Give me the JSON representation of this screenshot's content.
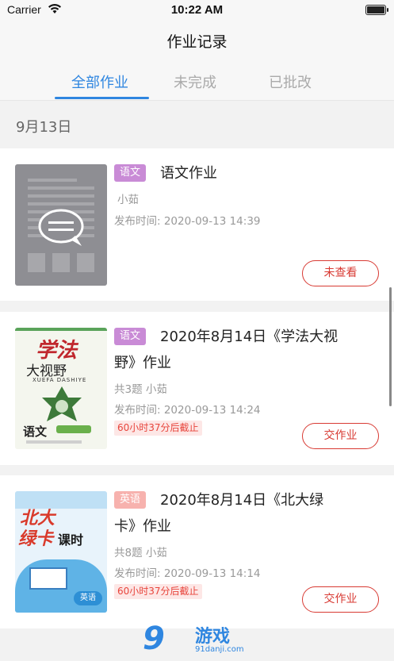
{
  "status_bar": {
    "carrier": "Carrier",
    "time": "10:22 AM"
  },
  "header": {
    "title": "作业记录"
  },
  "tabs": [
    {
      "label": "全部作业",
      "active": true
    },
    {
      "label": "未完成",
      "active": false
    },
    {
      "label": "已批改",
      "active": false
    }
  ],
  "date_header": "9月13日",
  "cards": [
    {
      "subject": "语文",
      "title_line1": "语文作业",
      "title_line2": "",
      "meta1": "小茹",
      "publish_time": "发布时间: 2020-09-13 14:39",
      "deadline": "",
      "action": "未查看"
    },
    {
      "subject": "语文",
      "title_line1": "2020年8月14日《学法大视",
      "title_line2": "野》作业",
      "meta1": "共3题 小茹",
      "publish_time": "发布时间: 2020-09-13 14:24",
      "deadline": "60小时37分后截止",
      "action": "交作业",
      "cover": {
        "title_a": "学法",
        "title_b": "大视野",
        "subtitle": "XUEFA DASHIYE",
        "subject": "语文"
      }
    },
    {
      "subject": "英语",
      "title_line1": "2020年8月14日《北大绿",
      "title_line2": "卡》作业",
      "meta1": "共8题 小茹",
      "publish_time": "发布时间: 2020-09-13 14:14",
      "deadline": "60小时37分后截止",
      "action": "交作业",
      "cover": {
        "title_a": "北大",
        "title_b": "绿卡",
        "title_c": "课时",
        "subject": "英语"
      }
    }
  ],
  "watermark": {
    "logo": "9",
    "text": "游戏",
    "url": "91danji.com"
  },
  "colors": {
    "accent": "#2f86e0",
    "danger": "#d83a33",
    "tag_yuwen": "#c98bd6",
    "tag_english": "#f7b2ae"
  }
}
